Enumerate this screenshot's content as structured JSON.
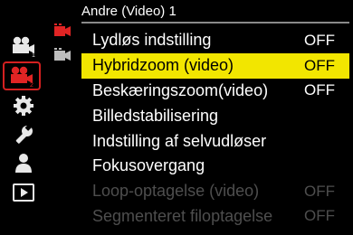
{
  "header": {
    "title": "Andre (Video) 1"
  },
  "colors": {
    "accent": "#d42020",
    "highlight": "#f2e600",
    "disabled": "#4e4e4e"
  },
  "categories": [
    {
      "icon": "movie-camera-1-icon",
      "badge": "1",
      "state": "normal"
    },
    {
      "icon": "movie-camera-2-icon",
      "badge": "2",
      "state": "selected"
    },
    {
      "icon": "gear-icon",
      "state": "normal"
    },
    {
      "icon": "wrench-icon",
      "state": "normal"
    },
    {
      "icon": "person-icon",
      "state": "normal"
    },
    {
      "icon": "playback-icon",
      "state": "normal"
    }
  ],
  "subtabs": [
    {
      "icon": "video-subpage-1-icon",
      "state": "active"
    },
    {
      "icon": "video-subpage-2-icon",
      "state": "inactive"
    }
  ],
  "menu": {
    "items": [
      {
        "label": "Lydløs indstilling",
        "value": "OFF",
        "state": "normal"
      },
      {
        "label": "Hybridzoom (video)",
        "value": "OFF",
        "state": "selected"
      },
      {
        "label": "Beskæringszoom(video)",
        "value": "OFF",
        "state": "normal"
      },
      {
        "label": "Billedstabilisering",
        "value": "",
        "state": "normal"
      },
      {
        "label": "Indstilling af selvudløser",
        "value": "",
        "state": "normal"
      },
      {
        "label": "Fokusovergang",
        "value": "",
        "state": "normal"
      },
      {
        "label": "Loop-optagelse (video)",
        "value": "OFF",
        "state": "disabled"
      },
      {
        "label": "Segmenteret filoptagelse",
        "value": "OFF",
        "state": "disabled"
      }
    ]
  }
}
